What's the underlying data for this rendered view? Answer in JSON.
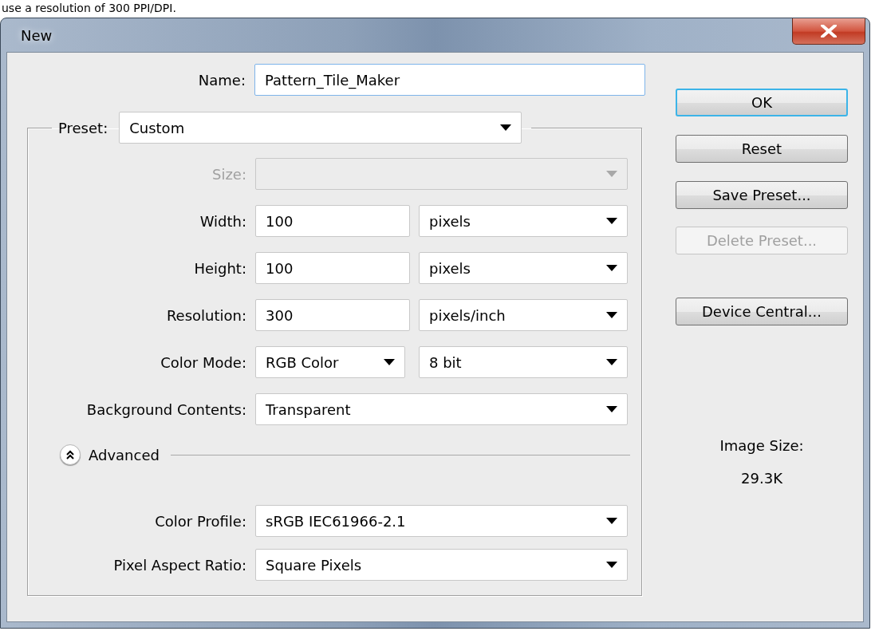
{
  "caption": "use a resolution of 300 PPI/DPI.",
  "window": {
    "title": "New"
  },
  "name": {
    "label": "Name:",
    "value": "Pattern_Tile_Maker",
    "focused": true
  },
  "preset": {
    "label": "Preset:",
    "value": "Custom"
  },
  "size": {
    "label": "Size:",
    "disabled": true
  },
  "fields": [
    {
      "kind": "input_unit",
      "label": "Width:",
      "value": "100",
      "unit": "pixels"
    },
    {
      "kind": "input_unit",
      "label": "Height:",
      "value": "100",
      "unit": "pixels"
    },
    {
      "kind": "input_unit",
      "label": "Resolution:",
      "value": "300",
      "unit": "pixels/inch"
    },
    {
      "kind": "dropdown_pair",
      "label": "Color Mode:",
      "value": "RGB Color",
      "unit": "8 bit"
    },
    {
      "kind": "dropdown",
      "label": "Background Contents:",
      "value": "Transparent"
    }
  ],
  "advanced": {
    "label": "Advanced",
    "expanded": true
  },
  "advanced_fields": [
    {
      "label": "Color Profile:",
      "value": "sRGB IEC61966-2.1"
    },
    {
      "label": "Pixel Aspect Ratio:",
      "value": "Square Pixels"
    }
  ],
  "buttons": [
    {
      "label": "OK",
      "default": true,
      "disabled": false
    },
    {
      "label": "Reset",
      "default": false,
      "disabled": false
    },
    {
      "label": "Save Preset...",
      "default": false,
      "disabled": false
    },
    {
      "label": "Delete Preset...",
      "default": false,
      "disabled": true
    },
    {
      "label": "Device Central...",
      "default": false,
      "disabled": false
    }
  ],
  "image_size": {
    "label": "Image Size:",
    "value": "29.3K"
  }
}
